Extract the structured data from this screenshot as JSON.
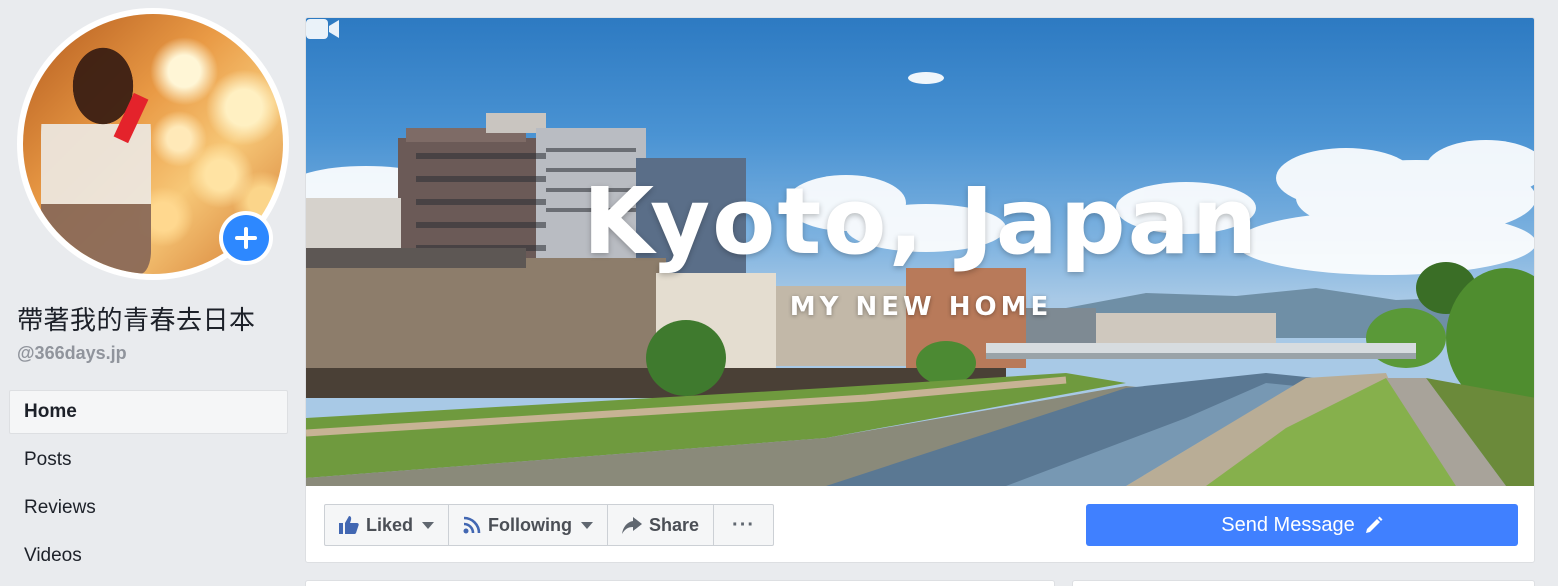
{
  "page": {
    "name": "帶著我的青春去日本",
    "handle": "@366days.jp"
  },
  "nav": {
    "items": [
      {
        "label": "Home",
        "active": true
      },
      {
        "label": "Posts",
        "active": false
      },
      {
        "label": "Reviews",
        "active": false
      },
      {
        "label": "Videos",
        "active": false
      }
    ]
  },
  "cover": {
    "title": "Kyoto, Japan",
    "subtitle": "MY NEW HOME",
    "video_icon": "video-camera-icon"
  },
  "actions": {
    "liked_label": "Liked",
    "following_label": "Following",
    "share_label": "Share",
    "more_label": "···"
  },
  "send_message": {
    "label": "Send Message",
    "icon": "pencil-icon"
  },
  "colors": {
    "background": "#e9ebee",
    "accent": "#4080ff",
    "add_photo": "#2d88ff",
    "handle_text": "#90949c"
  }
}
